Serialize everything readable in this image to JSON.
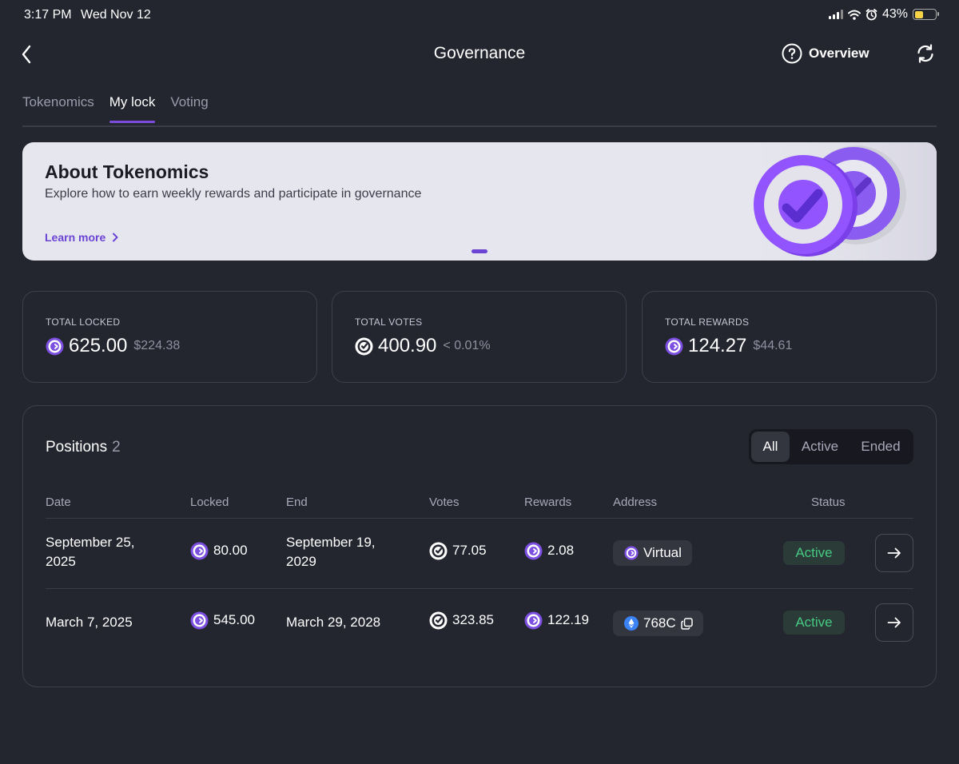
{
  "status_bar": {
    "time": "3:17 PM",
    "date": "Wed Nov 12",
    "battery": "43%",
    "battery_level": 0.43
  },
  "header": {
    "title": "Governance",
    "overview_label": "Overview"
  },
  "tabs": [
    {
      "label": "Tokenomics",
      "active": false
    },
    {
      "label": "My lock",
      "active": true
    },
    {
      "label": "Voting",
      "active": false
    }
  ],
  "banner": {
    "title": "About Tokenomics",
    "subtitle": "Explore how to earn weekly rewards and participate in governance",
    "link": "Learn more"
  },
  "stats": {
    "locked": {
      "label": "TOTAL LOCKED",
      "value": "625.00",
      "sub": "$224.38"
    },
    "votes": {
      "label": "TOTAL VOTES",
      "value": "400.90",
      "sub": "< 0.01%"
    },
    "rewards": {
      "label": "TOTAL REWARDS",
      "value": "124.27",
      "sub": "$44.61"
    }
  },
  "positions": {
    "title": "Positions",
    "count": "2",
    "filters": [
      "All",
      "Active",
      "Ended"
    ],
    "selected_filter": "All",
    "columns": [
      "Date",
      "Locked",
      "End",
      "Votes",
      "Rewards",
      "Address",
      "Status"
    ],
    "rows": [
      {
        "date": "September 25, 2025",
        "locked": "80.00",
        "end": "September 19, 2029",
        "votes": "77.05",
        "rewards": "2.08",
        "address": "Virtual",
        "status": "Active"
      },
      {
        "date": "March 7, 2025",
        "locked": "545.00",
        "end": "March 29, 2028",
        "votes": "323.85",
        "rewards": "122.19",
        "address": "768C",
        "status": "Active"
      }
    ]
  },
  "colors": {
    "background": "#23252f",
    "accent": "#7c4ddb",
    "status_active": "#47c883",
    "banner_bg": "#e6e6ee"
  }
}
